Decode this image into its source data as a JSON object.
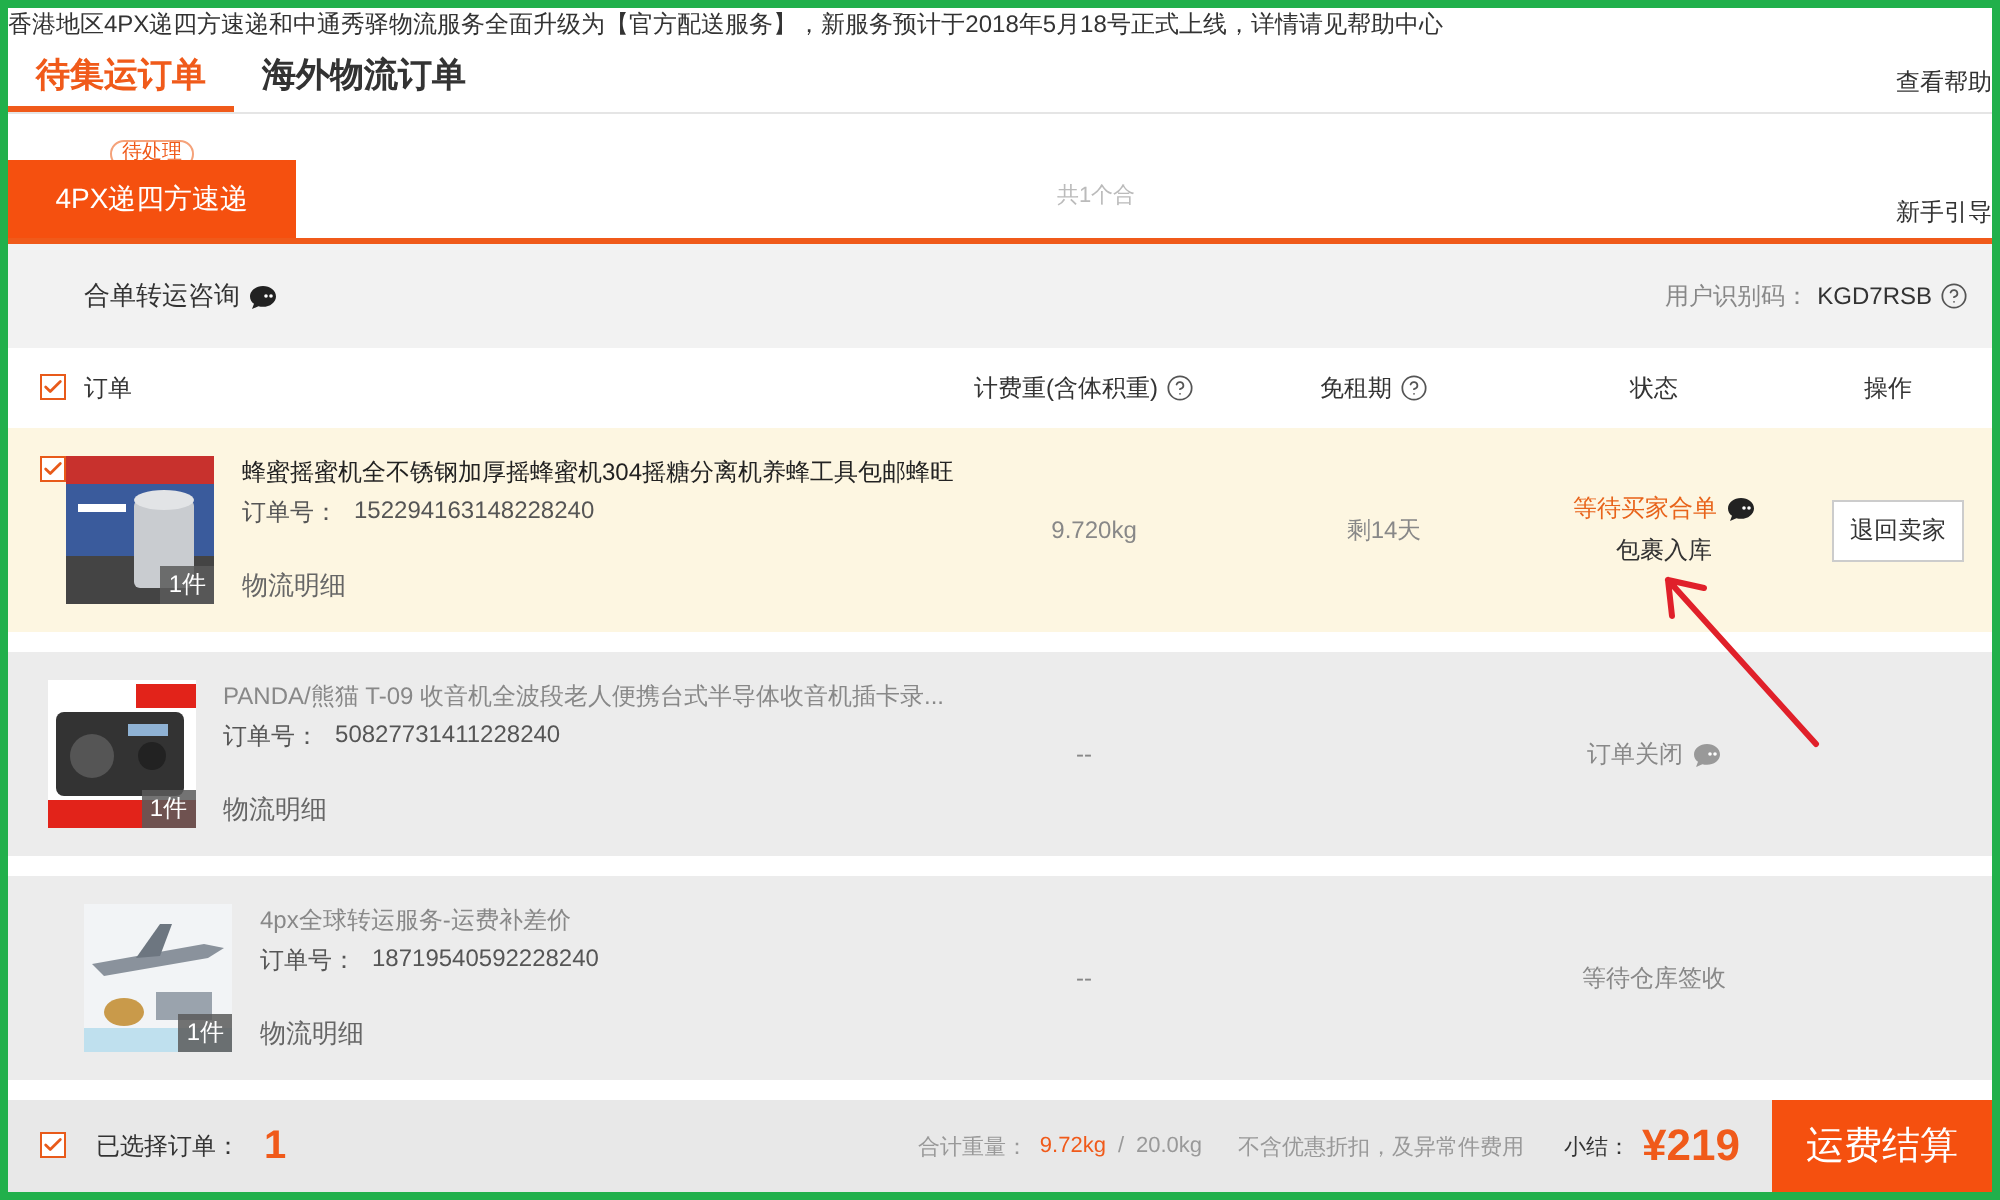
{
  "notice": "香港地区4PX递四方速递和中通秀驿物流服务全面升级为【官方配送服务】，新服务预计于2018年5月18号正式上线，详情请见帮助中心",
  "tabs": [
    {
      "label": "待集运订单",
      "selected": true
    },
    {
      "label": "海外物流订单",
      "selected": false
    }
  ],
  "help_link": "查看帮助",
  "carriers": [
    {
      "label": "4PX递四方速递",
      "badge": "待处理",
      "selected": true
    }
  ],
  "merge_count": "共1个合",
  "guide_link": "新手引导",
  "consult": {
    "label": "合单转运咨询",
    "user_code_label": "用户识别码：",
    "user_code": "KGD7RSB"
  },
  "header": {
    "checked": true,
    "order": "订单",
    "weight": "计费重(含体积重)",
    "free_period": "免租期",
    "status": "状态",
    "action": "操作"
  },
  "rows": [
    {
      "kind": "active",
      "checked": true,
      "qty": "1件",
      "title": "蜂蜜摇蜜机全不锈钢加厚摇蜂蜜机304摇糖分离机养蜂工具包邮蜂旺",
      "order_label": "订单号：",
      "order_no": "152294163148228240",
      "logistics": "物流明细",
      "weight": "9.720kg",
      "free_period": "剩14天",
      "status": "等待买家合单",
      "status_note": "包裹入库",
      "chat": true,
      "action": "退回卖家"
    },
    {
      "kind": "inactive",
      "qty": "1件",
      "title": "PANDA/熊猫 T-09 收音机全波段老人便携台式半导体收音机插卡录...",
      "order_label": "订单号：",
      "order_no": "50827731411228240",
      "logistics": "物流明细",
      "weight": "--",
      "status": "订单关闭",
      "chat": true
    },
    {
      "kind": "inactive",
      "qty": "1件",
      "title": "4px全球转运服务-运费补差价",
      "order_label": "订单号：",
      "order_no": "18719540592228240",
      "logistics": "物流明细",
      "weight": "--",
      "status": "等待仓库签收",
      "chat": false
    }
  ],
  "footer": {
    "checked": true,
    "selected_label": "已选择订单：",
    "selected_count": "1",
    "total_weight_label": "合计重量：",
    "total_weight": "9.72kg",
    "separator": "/",
    "weight_limit": "20.0kg",
    "note": "不含优惠折扣，及异常件费用",
    "subtotal_label": "小结：",
    "subtotal": "¥219",
    "checkout": "运费结算"
  }
}
